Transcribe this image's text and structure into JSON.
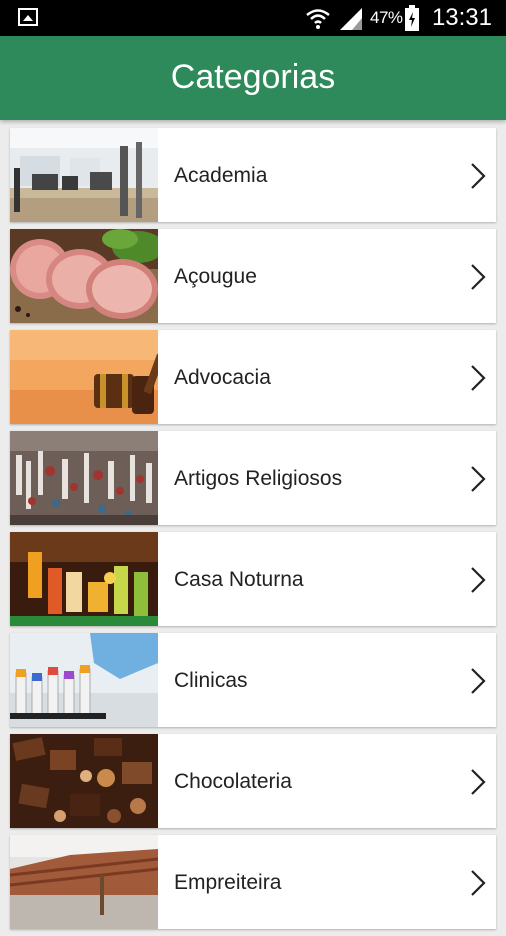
{
  "status_bar": {
    "battery_percent": "47%",
    "time": "13:31"
  },
  "header": {
    "title": "Categorias"
  },
  "categories": [
    {
      "label": "Academia",
      "image": "gym-photo"
    },
    {
      "label": "Açougue",
      "image": "meat-photo"
    },
    {
      "label": "Advocacia",
      "image": "gavel-photo"
    },
    {
      "label": "Artigos Religiosos",
      "image": "religious-items-photo"
    },
    {
      "label": "Casa Noturna",
      "image": "nightclub-drinks-photo"
    },
    {
      "label": "Clinicas",
      "image": "clinic-test-tubes-photo"
    },
    {
      "label": "Chocolateria",
      "image": "chocolates-photo"
    },
    {
      "label": "Empreiteira",
      "image": "construction-photo"
    }
  ],
  "colors": {
    "header_bg": "#2e8a5a",
    "page_bg": "#ececec"
  }
}
